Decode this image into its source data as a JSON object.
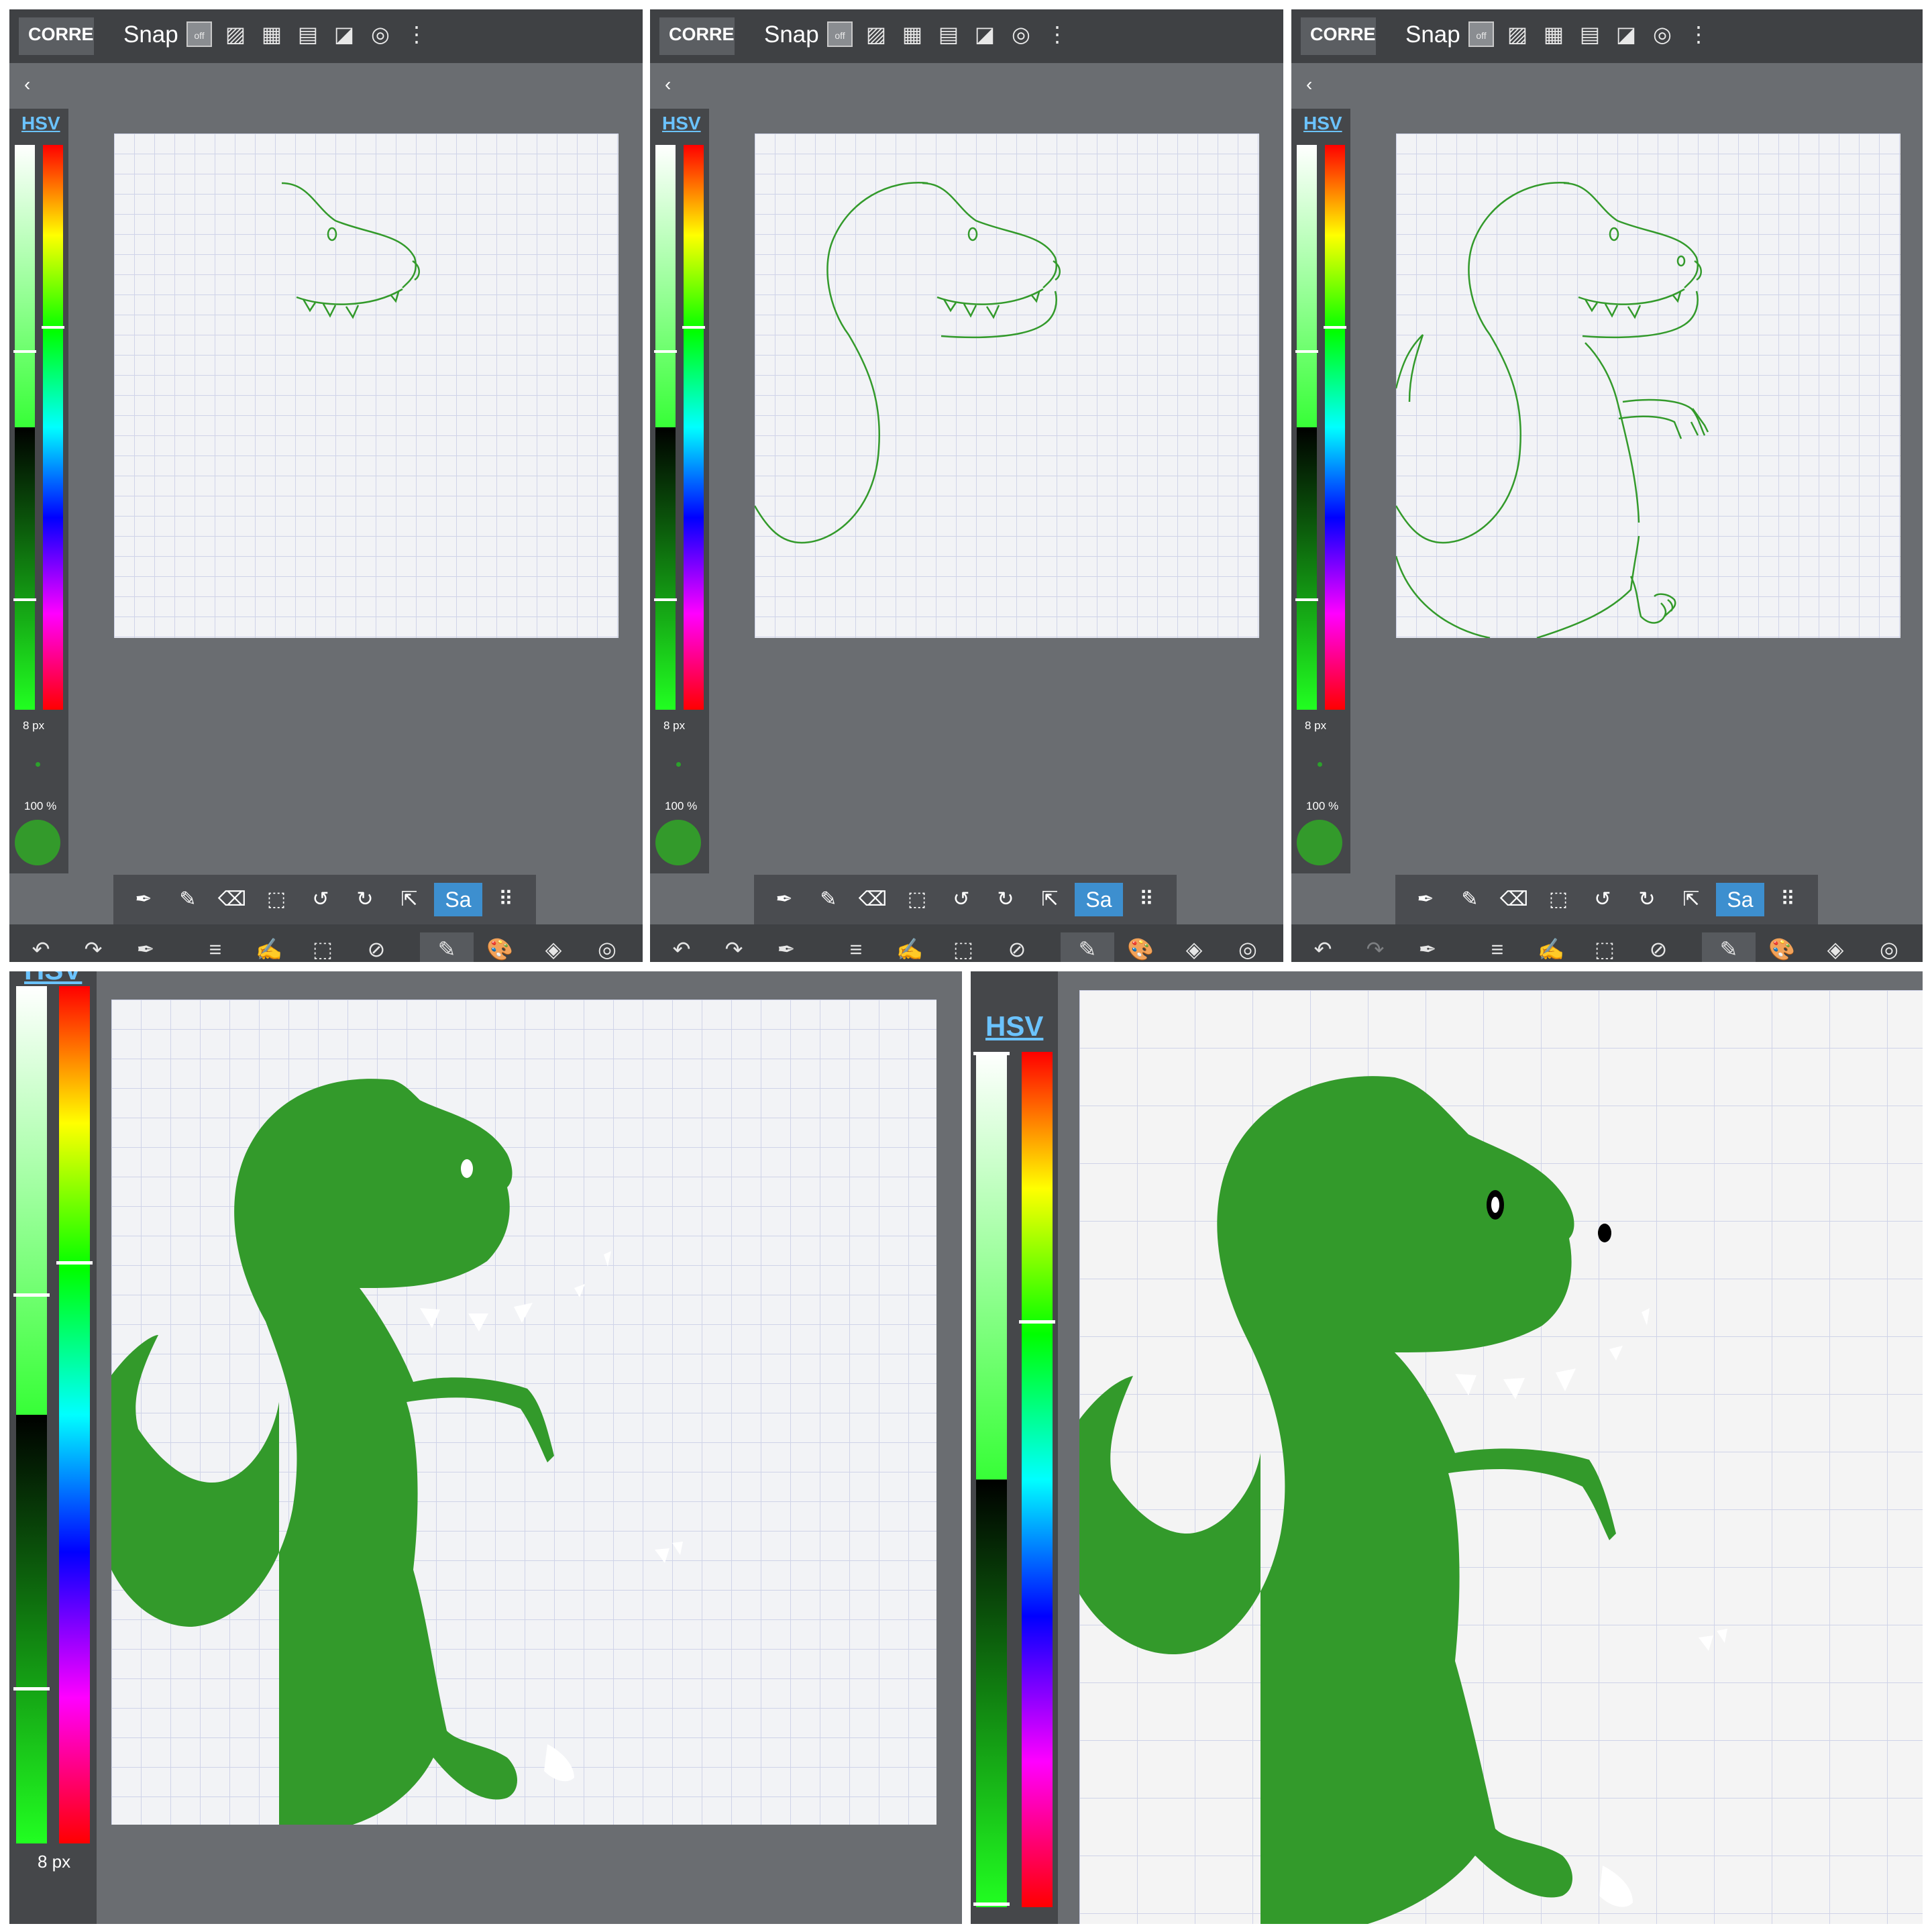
{
  "app": {
    "correction_label": "CORREC",
    "snap_label": "Snap",
    "snap_off_label": "off",
    "hsv_label": "HSV",
    "brush_size": "8 px",
    "opacity": "100 %",
    "sa_label": "Sa",
    "back_glyph": "‹"
  },
  "colors": {
    "stroke_green": "#339a2b",
    "topbar": "#3f4144",
    "panel": "#6a6d71",
    "accent_blue": "#3d8fcf",
    "hsv_blue": "#6bc3ff"
  },
  "snap_icons": [
    "snap-off-icon",
    "parallel-lines-icon",
    "grid-icon",
    "horizontal-lines-icon",
    "perspective-icon",
    "concentric-circles-icon",
    "more-icon"
  ],
  "tool_icons": [
    "eyedropper-icon",
    "pen-icon",
    "eraser-icon",
    "clear-selection-icon",
    "undo-rotate-icon",
    "redo-rotate-icon",
    "export-icon",
    "sa-icon",
    "grid-dots-icon"
  ],
  "bottom_icons": [
    "undo-icon",
    "redo-icon",
    "eyedropper-icon",
    "menu-icon",
    "edit-icon",
    "selection-icon",
    "transform-icon",
    "brush-icon",
    "palette-icon",
    "layers-icon",
    "settings-icon"
  ],
  "panels": [
    {
      "stage": "head-sketch"
    },
    {
      "stage": "body-sketch"
    },
    {
      "stage": "full-sketch"
    },
    {
      "stage": "filled"
    },
    {
      "stage": "filled-with-eyes"
    }
  ]
}
